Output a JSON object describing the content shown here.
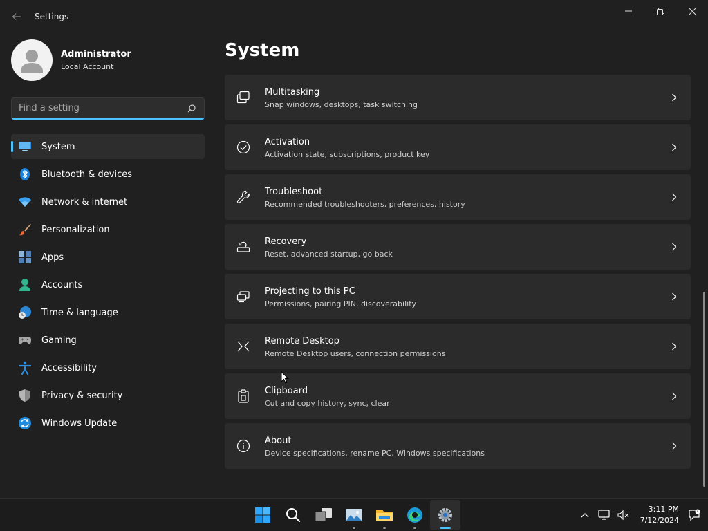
{
  "app": {
    "title": "Settings"
  },
  "profile": {
    "name": "Administrator",
    "account_type": "Local Account"
  },
  "search": {
    "placeholder": "Find a setting"
  },
  "sidebar": {
    "items": [
      {
        "label": "System",
        "icon": "monitor-icon",
        "selected": true
      },
      {
        "label": "Bluetooth & devices",
        "icon": "bluetooth-icon"
      },
      {
        "label": "Network & internet",
        "icon": "wifi-icon"
      },
      {
        "label": "Personalization",
        "icon": "brush-icon"
      },
      {
        "label": "Apps",
        "icon": "apps-icon"
      },
      {
        "label": "Accounts",
        "icon": "account-icon"
      },
      {
        "label": "Time & language",
        "icon": "clock-globe-icon"
      },
      {
        "label": "Gaming",
        "icon": "gamepad-icon"
      },
      {
        "label": "Accessibility",
        "icon": "accessibility-icon"
      },
      {
        "label": "Privacy & security",
        "icon": "shield-icon"
      },
      {
        "label": "Windows Update",
        "icon": "update-icon"
      }
    ]
  },
  "main": {
    "title": "System",
    "cards": [
      {
        "title": "Multitasking",
        "subtitle": "Snap windows, desktops, task switching",
        "icon": "multitasking-icon"
      },
      {
        "title": "Activation",
        "subtitle": "Activation state, subscriptions, product key",
        "icon": "check-circle-icon"
      },
      {
        "title": "Troubleshoot",
        "subtitle": "Recommended troubleshooters, preferences, history",
        "icon": "wrench-icon"
      },
      {
        "title": "Recovery",
        "subtitle": "Reset, advanced startup, go back",
        "icon": "recovery-icon"
      },
      {
        "title": "Projecting to this PC",
        "subtitle": "Permissions, pairing PIN, discoverability",
        "icon": "projecting-icon"
      },
      {
        "title": "Remote Desktop",
        "subtitle": "Remote Desktop users, connection permissions",
        "icon": "remote-desktop-icon"
      },
      {
        "title": "Clipboard",
        "subtitle": "Cut and copy history, sync, clear",
        "icon": "clipboard-icon"
      },
      {
        "title": "About",
        "subtitle": "Device specifications, rename PC, Windows specifications",
        "icon": "info-icon"
      }
    ]
  },
  "taskbar": {
    "apps": [
      "windows-start-icon",
      "search-icon",
      "task-view-icon",
      "photos-icon",
      "file-explorer-icon",
      "edge-icon",
      "settings-icon"
    ],
    "time": "3:11 PM",
    "date": "7/12/2024"
  },
  "colors": {
    "accent": "#4cc2ff",
    "background": "#202020",
    "card": "#2b2b2b"
  }
}
